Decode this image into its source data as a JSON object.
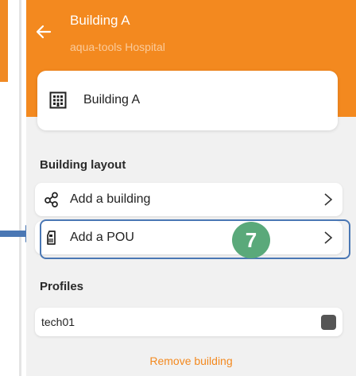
{
  "header": {
    "title": "Building A",
    "subtitle": "aqua-tools Hospital"
  },
  "building_card": {
    "label": "Building A"
  },
  "building_layout": {
    "heading": "Building layout",
    "items": [
      {
        "label": "Add a building",
        "icon": "hierarchy-nodes-icon"
      },
      {
        "label": "Add a POU",
        "icon": "shower-icon"
      }
    ]
  },
  "annotation": {
    "step_number": "7",
    "highlight_color": "#4a77b4",
    "badge_color": "#5aa97a"
  },
  "profiles": {
    "heading": "Profiles",
    "items": [
      {
        "label": "tech01"
      }
    ]
  },
  "footer": {
    "remove_label": "Remove building"
  },
  "colors": {
    "accent": "#f3891f",
    "background": "#f1f1f1",
    "card": "#ffffff"
  }
}
